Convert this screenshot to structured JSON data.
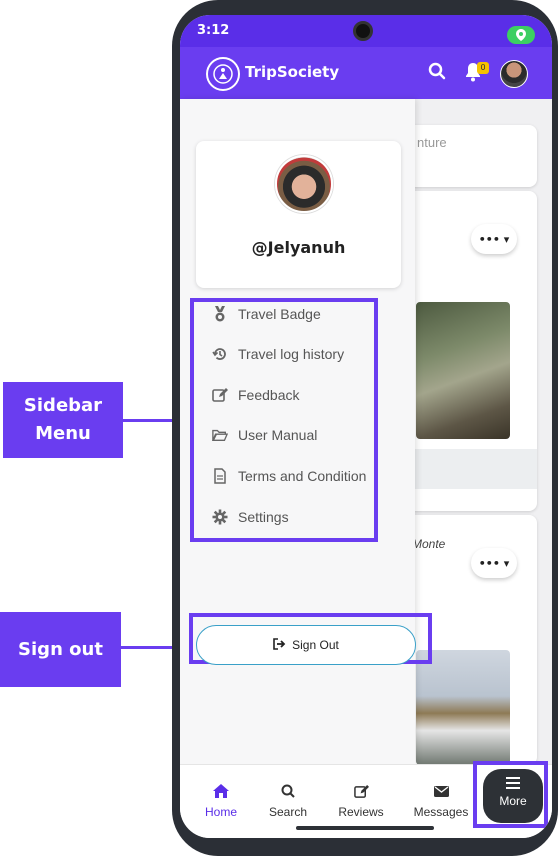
{
  "status": {
    "time": "3:12"
  },
  "app": {
    "title": "TripSociety",
    "notification_count": "0"
  },
  "feed": {
    "post_input_placeholder": "nture",
    "card3_location": "Monte",
    "menu_dots": "•••"
  },
  "sidebar": {
    "username": "@Jelyanuh",
    "items": [
      {
        "label": "Travel Badge",
        "icon": "medal-icon"
      },
      {
        "label": "Travel log history",
        "icon": "history-icon"
      },
      {
        "label": "Feedback",
        "icon": "edit-icon"
      },
      {
        "label": "User Manual",
        "icon": "folder-open-icon"
      },
      {
        "label": "Terms and Condition",
        "icon": "document-icon"
      },
      {
        "label": "Settings",
        "icon": "gear-icon"
      }
    ],
    "sign_out_label": "Sign Out"
  },
  "bottom_nav": {
    "home": "Home",
    "search": "Search",
    "reviews": "Reviews",
    "messages": "Messages",
    "more": "More"
  },
  "callouts": {
    "sidebar_menu": "Sidebar\nMenu",
    "sign_out": "Sign out"
  },
  "colors": {
    "accent": "#6a3df0",
    "status_bar": "#5a2ee8",
    "active_nav": "#5a2ee8",
    "more_button": "#2d3136"
  }
}
